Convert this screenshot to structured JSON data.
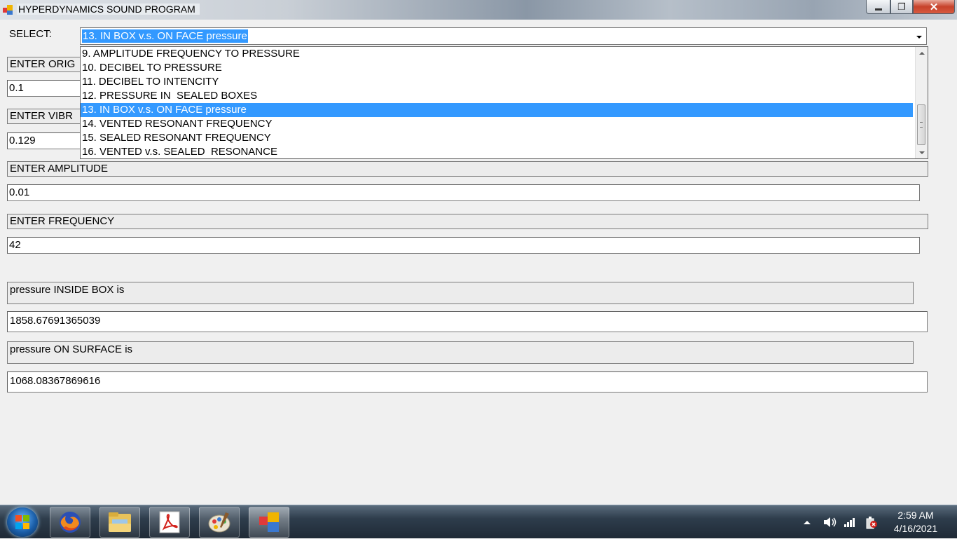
{
  "window": {
    "title": "HYPERDYNAMICS SOUND PROGRAM",
    "close_glyph": "✕",
    "maximize_glyph": "❐"
  },
  "form": {
    "select_label": "SELECT:",
    "selected_option": "13. IN BOX v.s. ON FACE pressure",
    "dropdown_items": [
      "9. AMPLITUDE FREQUENCY TO PRESSURE",
      "10. DECIBEL TO PRESSURE",
      "11. DECIBEL TO INTENCITY",
      "12. PRESSURE IN  SEALED BOXES",
      "13. IN BOX v.s. ON FACE pressure",
      "14. VENTED RESONANT FREQUENCY",
      "15. SEALED RESONANT FREQUENCY",
      "16. VENTED v.s. SEALED  RESONANCE"
    ],
    "origin_label_partial": "ENTER ORIG",
    "origin_value": "0.1",
    "vibration_label_partial": "ENTER VIBR",
    "vibration_value": "0.129",
    "amplitude_label": "ENTER AMPLITUDE",
    "amplitude_value": "0.01",
    "frequency_label": "ENTER FREQUENCY",
    "frequency_value": "42",
    "inside_label": "pressure INSIDE BOX is",
    "inside_value": "1858.67691365039",
    "surface_label": "pressure ON SURFACE is",
    "surface_value": "1068.08367869616"
  },
  "taskbar": {
    "apps": [
      "firefox-icon",
      "file-explorer-icon",
      "acrobat-icon",
      "paint-icon",
      "sound-program-icon"
    ],
    "time": "2:59 AM",
    "date": "4/16/2021"
  },
  "colors": {
    "selection": "#3399ff",
    "close_button": "#c7422b"
  }
}
